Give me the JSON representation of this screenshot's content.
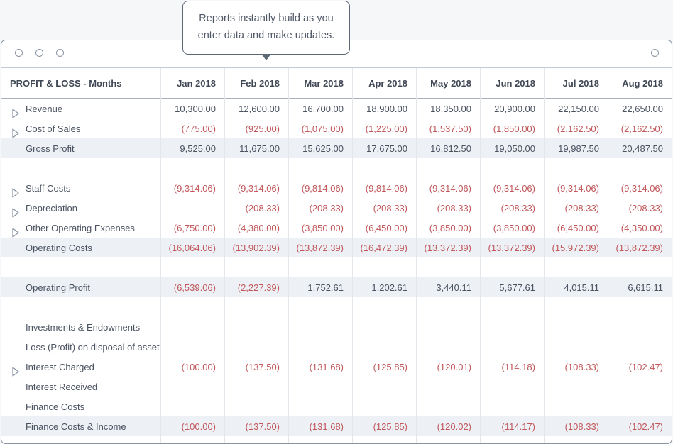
{
  "tooltip": {
    "line1": "Reports instantly build as you",
    "line2": "enter data and make updates."
  },
  "report": {
    "title": "PROFIT & LOSS - Months",
    "months": [
      "Jan 2018",
      "Feb 2018",
      "Mar 2018",
      "Apr 2018",
      "May 2018",
      "Jun 2018",
      "Jul 2018",
      "Aug 2018"
    ],
    "rows": [
      {
        "label": "Revenue",
        "expand": true,
        "shade": false,
        "values": [
          "10,300.00",
          "12,600.00",
          "16,700.00",
          "18,900.00",
          "18,350.00",
          "20,900.00",
          "22,150.00",
          "22,650.00"
        ]
      },
      {
        "label": "Cost of Sales",
        "expand": true,
        "shade": false,
        "values": [
          "(775.00)",
          "(925.00)",
          "(1,075.00)",
          "(1,225.00)",
          "(1,537.50)",
          "(1,850.00)",
          "(2,162.50)",
          "(2,162.50)"
        ]
      },
      {
        "label": "Gross Profit",
        "expand": false,
        "shade": true,
        "values": [
          "9,525.00",
          "11,675.00",
          "15,625.00",
          "17,675.00",
          "16,812.50",
          "19,050.00",
          "19,987.50",
          "20,487.50"
        ]
      },
      {
        "spacer": true
      },
      {
        "label": "Staff Costs",
        "expand": true,
        "shade": false,
        "values": [
          "(9,314.06)",
          "(9,314.06)",
          "(9,814.06)",
          "(9,814.06)",
          "(9,314.06)",
          "(9,314.06)",
          "(9,314.06)",
          "(9,314.06)"
        ]
      },
      {
        "label": "Depreciation",
        "expand": true,
        "shade": false,
        "values": [
          "",
          "(208.33)",
          "(208.33)",
          "(208.33)",
          "(208.33)",
          "(208.33)",
          "(208.33)",
          "(208.33)"
        ]
      },
      {
        "label": "Other Operating Expenses",
        "expand": true,
        "shade": false,
        "values": [
          "(6,750.00)",
          "(4,380.00)",
          "(3,850.00)",
          "(6,450.00)",
          "(3,850.00)",
          "(3,850.00)",
          "(6,450.00)",
          "(4,350.00)"
        ]
      },
      {
        "label": "Operating Costs",
        "expand": false,
        "shade": true,
        "values": [
          "(16,064.06)",
          "(13,902.39)",
          "(13,872.39)",
          "(16,472.39)",
          "(13,372.39)",
          "(13,372.39)",
          "(15,972.39)",
          "(13,872.39)"
        ]
      },
      {
        "spacer": true
      },
      {
        "label": "Operating Profit",
        "expand": false,
        "shade": true,
        "values": [
          "(6,539.06)",
          "(2,227.39)",
          "1,752.61",
          "1,202.61",
          "3,440.11",
          "5,677.61",
          "4,015.11",
          "6,615.11"
        ]
      },
      {
        "spacer": true
      },
      {
        "label": "Investments & Endowments",
        "expand": false,
        "shade": false,
        "values": [
          "",
          "",
          "",
          "",
          "",
          "",
          "",
          ""
        ]
      },
      {
        "label": "Loss (Profit) on disposal of asset",
        "expand": false,
        "shade": false,
        "values": [
          "",
          "",
          "",
          "",
          "",
          "",
          "",
          ""
        ]
      },
      {
        "label": "Interest Charged",
        "expand": true,
        "shade": false,
        "values": [
          "(100.00)",
          "(137.50)",
          "(131.68)",
          "(125.85)",
          "(120.01)",
          "(114.18)",
          "(108.33)",
          "(102.47)"
        ]
      },
      {
        "label": "Interest Received",
        "expand": false,
        "shade": false,
        "values": [
          "",
          "",
          "",
          "",
          "",
          "",
          "",
          ""
        ]
      },
      {
        "label": "Finance Costs",
        "expand": false,
        "shade": false,
        "values": [
          "",
          "",
          "",
          "",
          "",
          "",
          "",
          ""
        ]
      },
      {
        "label": "Finance Costs & Income",
        "expand": false,
        "shade": true,
        "values": [
          "(100.00)",
          "(137.50)",
          "(131.68)",
          "(125.85)",
          "(120.02)",
          "(114.17)",
          "(108.33)",
          "(102.47)"
        ]
      }
    ]
  },
  "icons": {
    "expand": "triangle-right-icon"
  },
  "colors": {
    "negative": "#c0575a",
    "shade": "#edf1f6",
    "border": "#8a94a3"
  }
}
